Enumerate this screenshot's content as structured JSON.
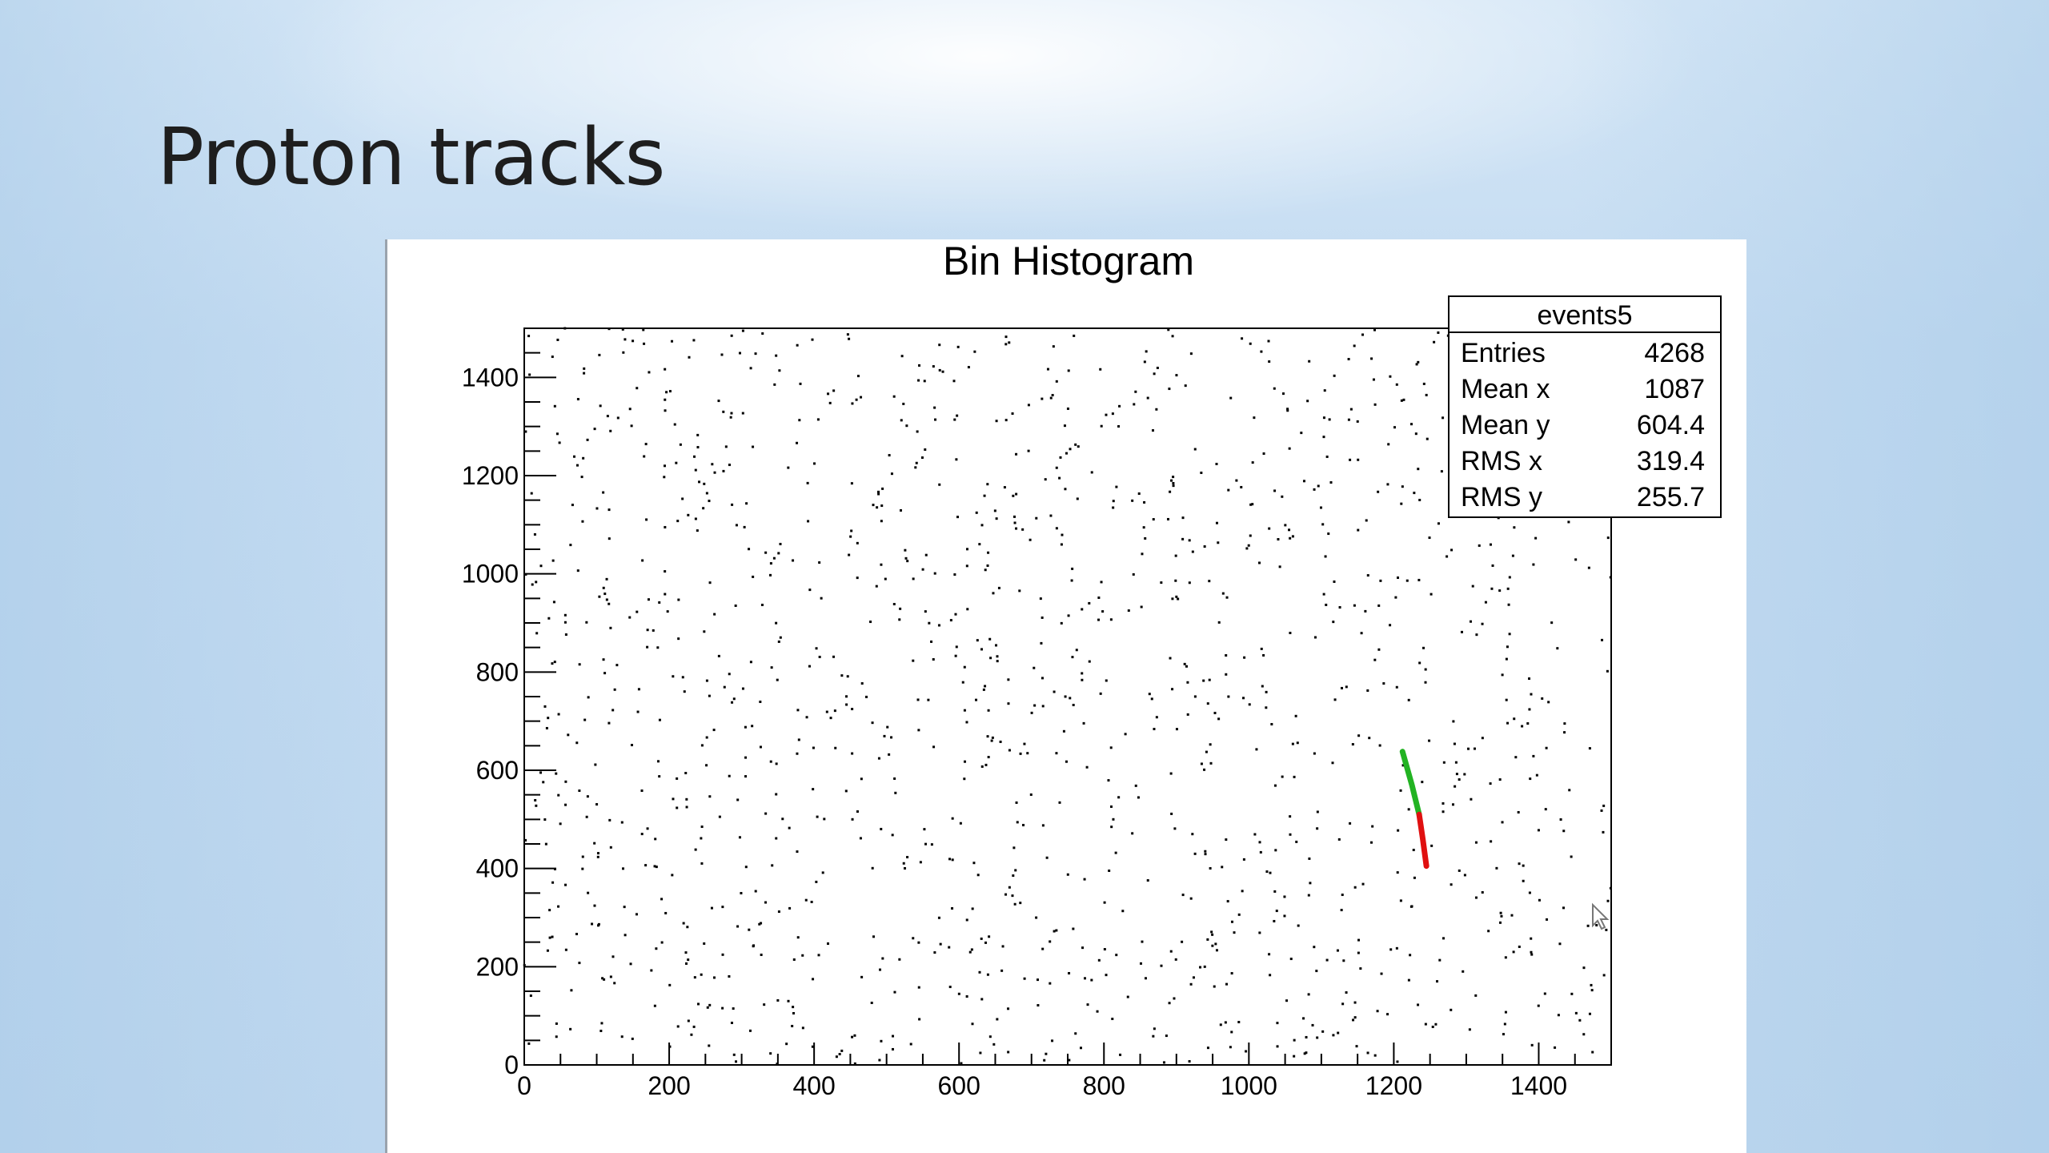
{
  "slide": {
    "title": "Proton tracks"
  },
  "chart_data": {
    "type": "scatter",
    "title": "Bin Histogram",
    "xlabel": "",
    "ylabel": "",
    "xlim": [
      0,
      1500
    ],
    "ylim": [
      0,
      1500
    ],
    "x_ticks": [
      0,
      200,
      400,
      600,
      800,
      1000,
      1200,
      1400
    ],
    "y_ticks": [
      0,
      200,
      400,
      600,
      800,
      1000,
      1200,
      1400
    ],
    "grid": false,
    "marker_color": "#000000",
    "scatter_points_shown": 1300,
    "scatter_seed": 5,
    "tracks": [
      {
        "color": "#22b322",
        "points": [
          [
            1212,
            638
          ],
          [
            1225,
            570
          ],
          [
            1235,
            510
          ]
        ]
      },
      {
        "color": "#e01010",
        "points": [
          [
            1235,
            510
          ],
          [
            1240,
            460
          ],
          [
            1245,
            405
          ]
        ]
      }
    ],
    "stats_box": {
      "name": "events5",
      "rows": [
        {
          "label": "Entries",
          "value": "4268"
        },
        {
          "label": "Mean x",
          "value": "1087"
        },
        {
          "label": "Mean y",
          "value": "604.4"
        },
        {
          "label": "RMS x",
          "value": "319.4"
        },
        {
          "label": "RMS y",
          "value": "255.7"
        }
      ]
    }
  }
}
